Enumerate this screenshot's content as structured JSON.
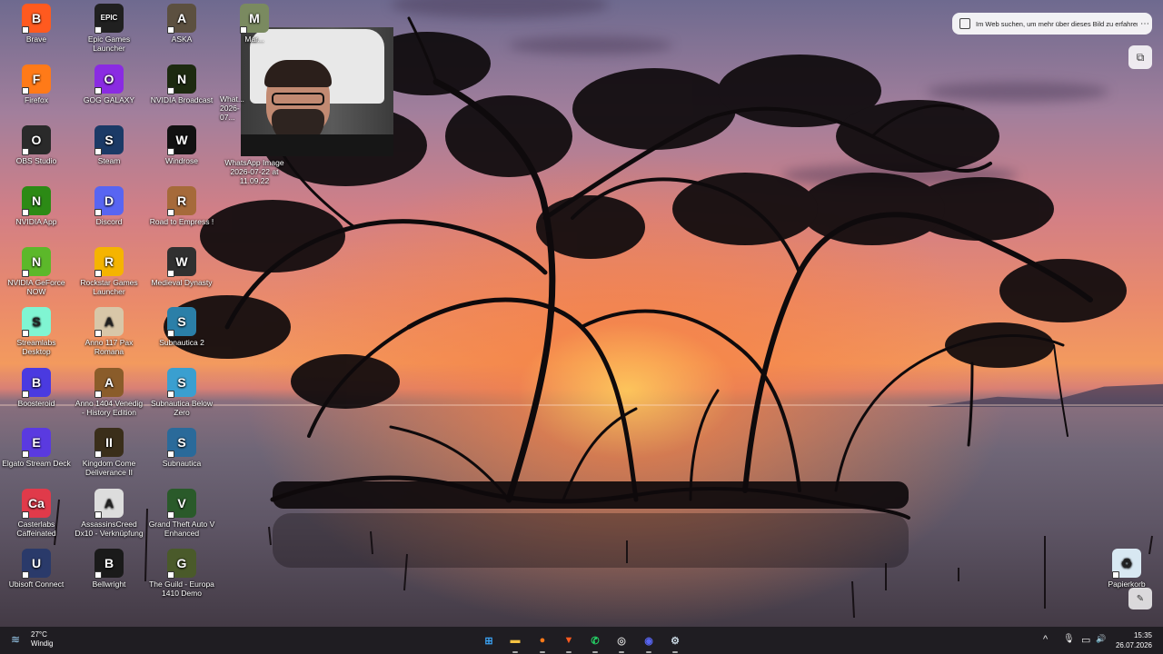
{
  "desktop": {
    "icons": [
      {
        "label": "Brave",
        "icon": "brave-icon",
        "color": "#ff5a1f",
        "glyph": "B"
      },
      {
        "label": "Epic Games Launcher",
        "icon": "epic-games-icon",
        "color": "#202020",
        "glyph": "EPIC"
      },
      {
        "label": "ASKA",
        "icon": "aska-icon",
        "color": "#5c5040",
        "glyph": "A"
      },
      {
        "label": "Mar...",
        "icon": "castle-icon",
        "color": "#7a8a60",
        "glyph": "M"
      },
      {
        "label": "Firefox",
        "icon": "firefox-icon",
        "color": "#ff7a18",
        "glyph": "F"
      },
      {
        "label": "GOG GALAXY",
        "icon": "gog-galaxy-icon",
        "color": "#8a2be2",
        "glyph": "O"
      },
      {
        "label": "NVIDIA Broadcast",
        "icon": "nvidia-broadcast-icon",
        "color": "#1d2a10",
        "glyph": "N"
      },
      {
        "label": "OBS Studio",
        "icon": "obs-icon",
        "color": "#2a2a2a",
        "glyph": "O"
      },
      {
        "label": "Steam",
        "icon": "steam-icon",
        "color": "#1b3a66",
        "glyph": "S"
      },
      {
        "label": "Windrose",
        "icon": "windrose-icon",
        "color": "#111111",
        "glyph": "W"
      },
      {
        "label": "NVIDIA App",
        "icon": "nvidia-app-icon",
        "color": "#2c8a15",
        "glyph": "N"
      },
      {
        "label": "Discord",
        "icon": "discord-icon",
        "color": "#5865f2",
        "glyph": "D"
      },
      {
        "label": "Road to Empress !",
        "icon": "road-to-empress-icon",
        "color": "#a66a3a",
        "glyph": "R"
      },
      {
        "label": "NVIDIA GeForce NOW",
        "icon": "geforce-now-icon",
        "color": "#5cb82a",
        "glyph": "N"
      },
      {
        "label": "Rockstar Games Launcher",
        "icon": "rockstar-icon",
        "color": "#f5b400",
        "glyph": "R"
      },
      {
        "label": "Medieval Dynasty",
        "icon": "medieval-dynasty-icon",
        "color": "#303030",
        "glyph": "W"
      },
      {
        "label": "Streamlabs Desktop",
        "icon": "streamlabs-icon",
        "color": "#80f5d2",
        "glyph": "S"
      },
      {
        "label": "Anno 117 Pax Romana",
        "icon": "anno-117-icon",
        "color": "#d8c7a8",
        "glyph": "A"
      },
      {
        "label": "Subnautica 2",
        "icon": "subnautica-2-icon",
        "color": "#2b7fa8",
        "glyph": "S"
      },
      {
        "label": "Boosteroid",
        "icon": "boosteroid-icon",
        "color": "#4a3ae0",
        "glyph": "B"
      },
      {
        "label": "Anno 1404 Venedig - History Edition",
        "icon": "anno-1404-icon",
        "color": "#8a5c2a",
        "glyph": "A"
      },
      {
        "label": "Subnautica Below Zero",
        "icon": "subnautica-below-zero-icon",
        "color": "#3a9fd0",
        "glyph": "S"
      },
      {
        "label": "Elgato Stream Deck",
        "icon": "stream-deck-icon",
        "color": "#5a3ae0",
        "glyph": "E"
      },
      {
        "label": "Kingdom Come Deliverance II",
        "icon": "kingdom-come-icon",
        "color": "#3a2e1a",
        "glyph": "II"
      },
      {
        "label": "Subnautica",
        "icon": "subnautica-icon",
        "color": "#2a6a9a",
        "glyph": "S"
      },
      {
        "label": "Casterlabs Caffeinated",
        "icon": "casterlabs-icon",
        "color": "#e03a4a",
        "glyph": "Ca"
      },
      {
        "label": "AssassinsCreed Dx10 - Verknüpfung",
        "icon": "assassins-creed-icon",
        "color": "#dddddd",
        "glyph": "A"
      },
      {
        "label": "Grand Theft Auto V Enhanced",
        "icon": "gta-v-icon",
        "color": "#2a5a2a",
        "glyph": "V"
      },
      {
        "label": "Ubisoft Connect",
        "icon": "ubisoft-icon",
        "color": "#2a3a6a",
        "glyph": "U"
      },
      {
        "label": "Bellwright",
        "icon": "bellwright-icon",
        "color": "#1a1a1a",
        "glyph": "B"
      },
      {
        "label": "The Guild - Europa 1410 Demo",
        "icon": "the-guild-icon",
        "color": "#4a5a2a",
        "glyph": "G"
      },
      {
        "label": "Papierkorb",
        "icon": "recycle-bin-icon",
        "color": "#d8e8f2",
        "glyph": "♻"
      }
    ],
    "whatsapp_image": {
      "label_line1": "WhatsApp Image",
      "label_line2": "2026-07-22 at 11.09.22",
      "partial_label_line1": "What...",
      "partial_label_line2": "2026-07..."
    },
    "web_search": {
      "text": "Im Web suchen, um mehr über dieses Bild zu erfahren",
      "more": "⋯"
    },
    "lens_button": {
      "glyph": "⧉"
    },
    "corner_button": {
      "glyph": "✎"
    }
  },
  "taskbar": {
    "weather": {
      "temp": "27°C",
      "condition": "Windig"
    },
    "apps": [
      {
        "name": "start",
        "icon": "windows-start-icon",
        "glyph": "⊞",
        "color": "#3aa0f0"
      },
      {
        "name": "explorer",
        "icon": "file-explorer-icon",
        "glyph": "▬",
        "color": "#f5c242"
      },
      {
        "name": "firefox",
        "icon": "firefox-icon",
        "glyph": "●",
        "color": "#ff7a18"
      },
      {
        "name": "brave",
        "icon": "brave-icon",
        "glyph": "▼",
        "color": "#ff5a1f"
      },
      {
        "name": "whatsapp",
        "icon": "whatsapp-icon",
        "glyph": "✆",
        "color": "#25d366"
      },
      {
        "name": "obs",
        "icon": "obs-icon",
        "glyph": "◎",
        "color": "#cccccc"
      },
      {
        "name": "discord",
        "icon": "discord-icon",
        "glyph": "◉",
        "color": "#5865f2"
      },
      {
        "name": "steam",
        "icon": "steam-icon",
        "glyph": "⚙",
        "color": "#c7d5e0"
      }
    ],
    "tray": {
      "chevron": "^",
      "mic": "🎙",
      "display": "▭",
      "volume": "🔊"
    },
    "clock": {
      "time": "15:35",
      "date": "26.07.2026"
    }
  }
}
